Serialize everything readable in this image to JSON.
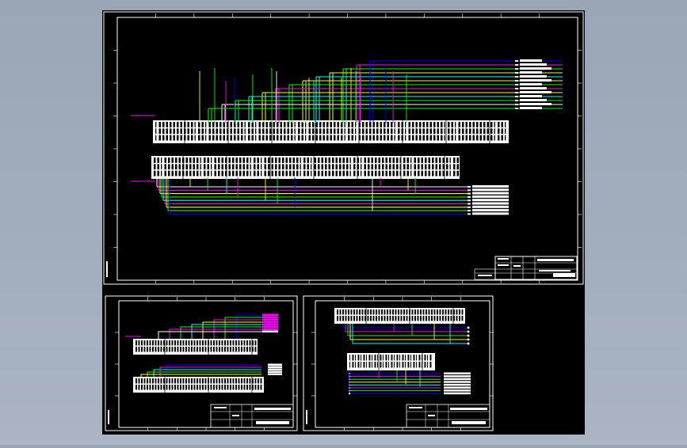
{
  "colors": {
    "background": "#a3aebc",
    "canvas": "#000000",
    "frame": "#ffffff",
    "wires": [
      "#0000ff",
      "#ff00ff",
      "#00ff00",
      "#ffff00",
      "#00ffff",
      "#ffffff"
    ]
  },
  "canvas": {
    "description_free": true
  },
  "sheets": [
    {
      "id": "sheet-main",
      "title_block_label": ""
    },
    {
      "id": "sheet-left",
      "title_block_label": ""
    },
    {
      "id": "sheet-right",
      "title_block_label": ""
    }
  ]
}
